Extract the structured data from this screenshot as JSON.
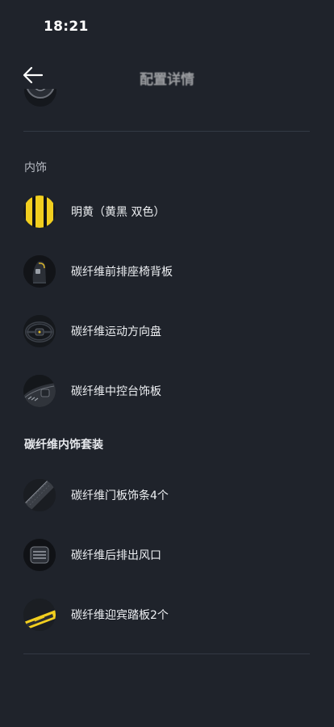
{
  "status_bar": {
    "time": "18:21"
  },
  "header": {
    "title": "配置详情",
    "back_icon": "arrow-left-icon"
  },
  "sections": [
    {
      "label": "内饰",
      "items": [
        {
          "label": "明黄（黄黑 双色）",
          "icon": "yellow-black-stripes-swatch"
        },
        {
          "label": "碳纤维前排座椅背板",
          "icon": "seat-back-thumbnail"
        },
        {
          "label": "碳纤维运动方向盘",
          "icon": "steering-wheel-thumbnail"
        },
        {
          "label": "碳纤维中控台饰板",
          "icon": "center-console-thumbnail"
        }
      ]
    },
    {
      "label": "碳纤维内饰套装",
      "items": [
        {
          "label": "碳纤维门板饰条4个",
          "icon": "door-trim-thumbnail"
        },
        {
          "label": "碳纤维后排出风口",
          "icon": "rear-vent-thumbnail"
        },
        {
          "label": "碳纤维迎宾踏板2个",
          "icon": "sill-plate-thumbnail"
        }
      ]
    }
  ],
  "colors": {
    "background": "#1f232b",
    "divider": "#333944",
    "accent_yellow": "#f2cf1f"
  }
}
